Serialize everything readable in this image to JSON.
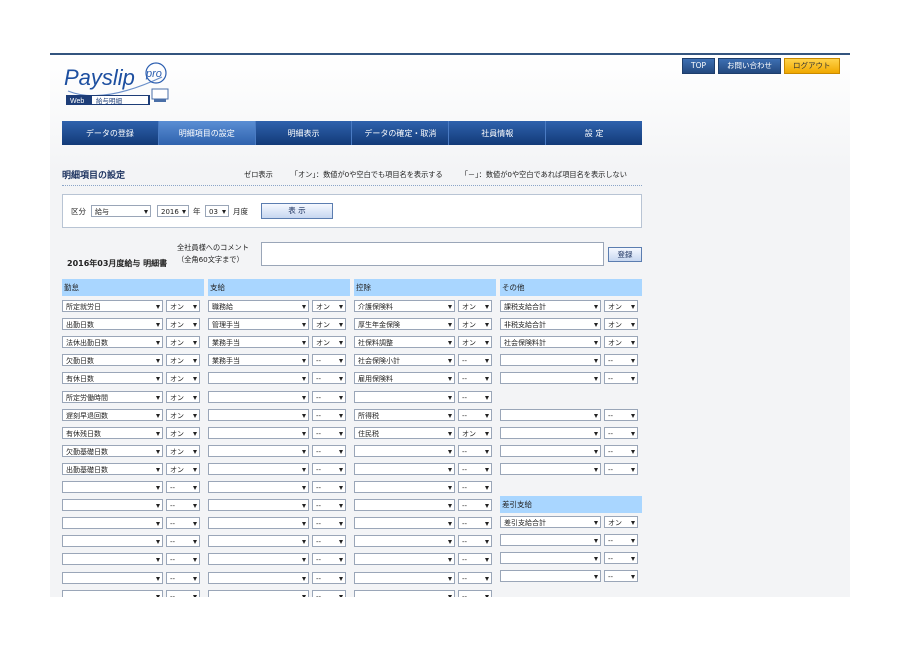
{
  "header": {
    "logo_text": "Payslip",
    "logo_pro": "pro",
    "logo_web": "Web",
    "logo_sub": "給与明細",
    "links": [
      {
        "label": "TOP",
        "name": "top-link"
      },
      {
        "label": "お問い合わせ",
        "name": "contact-link"
      },
      {
        "label": "ログアウト",
        "name": "logout-button"
      }
    ]
  },
  "nav": {
    "tabs": [
      {
        "label": "データの登録"
      },
      {
        "label": "明細項目の設定"
      },
      {
        "label": "明細表示"
      },
      {
        "label": "データの確定・取消"
      },
      {
        "label": "社員情報"
      },
      {
        "label": "設 定"
      }
    ]
  },
  "page": {
    "title": "明細項目の設定",
    "zero_label": "ゼロ表示",
    "zero_on": "「オン」：数値が0や空白でも項目名を表示する",
    "zero_off": "「－」：数値が0や空白であれば項目名を表示しない"
  },
  "selector": {
    "kubun_label": "区分",
    "kubun_value": "給与",
    "year_value": "2016",
    "year_label": "年",
    "month_value": "03",
    "month_label": "月度",
    "show_button": "表 示"
  },
  "comment": {
    "label_line1": "全社員様へのコメント",
    "label_line2": "（全角60文字まで）",
    "statement_title": "2016年03月度給与 明細書",
    "register_button": "登録"
  },
  "columns": [
    {
      "header": "勤怠",
      "items": [
        {
          "name": "所定就労日",
          "zero": "オン"
        },
        {
          "name": "出勤日数",
          "zero": "オン"
        },
        {
          "name": "法休出勤日数",
          "zero": "オン"
        },
        {
          "name": "欠勤日数",
          "zero": "オン"
        },
        {
          "name": "有休日数",
          "zero": "オン"
        },
        {
          "name": "所定労働時間",
          "zero": "オン"
        },
        {
          "name": "遅刻早退回数",
          "zero": "オン"
        },
        {
          "name": "有休残日数",
          "zero": "オン"
        },
        {
          "name": "欠勤基礎日数",
          "zero": "オン"
        },
        {
          "name": "出勤基礎日数",
          "zero": "オン"
        },
        {
          "name": "",
          "zero": "--"
        },
        {
          "name": "",
          "zero": "--"
        },
        {
          "name": "",
          "zero": "--"
        },
        {
          "name": "",
          "zero": "--"
        },
        {
          "name": "",
          "zero": "--"
        },
        {
          "name": "",
          "zero": "--"
        },
        {
          "name": "",
          "zero": "--"
        }
      ]
    },
    {
      "header": "支給",
      "items": [
        {
          "name": "職務給",
          "zero": "オン"
        },
        {
          "name": "管理手当",
          "zero": "オン"
        },
        {
          "name": "業務手当",
          "zero": "オン"
        },
        {
          "name": "業務手当",
          "zero": "--"
        },
        {
          "name": "",
          "zero": "--"
        },
        {
          "name": "",
          "zero": "--"
        },
        {
          "name": "",
          "zero": "--"
        },
        {
          "name": "",
          "zero": "--"
        },
        {
          "name": "",
          "zero": "--"
        },
        {
          "name": "",
          "zero": "--"
        },
        {
          "name": "",
          "zero": "--"
        },
        {
          "name": "",
          "zero": "--"
        },
        {
          "name": "",
          "zero": "--"
        },
        {
          "name": "",
          "zero": "--"
        },
        {
          "name": "",
          "zero": "--"
        },
        {
          "name": "",
          "zero": "--"
        },
        {
          "name": "",
          "zero": "--"
        }
      ]
    },
    {
      "header": "控除",
      "items": [
        {
          "name": "介護保険料",
          "zero": "オン"
        },
        {
          "name": "厚生年金保険",
          "zero": "オン"
        },
        {
          "name": "社保料調整",
          "zero": "オン"
        },
        {
          "name": "社会保険小計",
          "zero": "--"
        },
        {
          "name": "雇用保険料",
          "zero": "--"
        },
        {
          "name": "",
          "zero": "--"
        },
        {
          "name": "所得税",
          "zero": "--"
        },
        {
          "name": "住民税",
          "zero": "オン"
        },
        {
          "name": "",
          "zero": "--"
        },
        {
          "name": "",
          "zero": "--"
        },
        {
          "name": "",
          "zero": "--"
        },
        {
          "name": "",
          "zero": "--"
        },
        {
          "name": "",
          "zero": "--"
        },
        {
          "name": "",
          "zero": "--"
        },
        {
          "name": "",
          "zero": "--"
        },
        {
          "name": "",
          "zero": "--"
        },
        {
          "name": "",
          "zero": "--"
        }
      ]
    },
    {
      "header": "その他",
      "items": [
        {
          "name": "課税支給合計",
          "zero": "オン"
        },
        {
          "name": "非税支給合計",
          "zero": "オン"
        },
        {
          "name": "社会保険料計",
          "zero": "オン"
        },
        {
          "name": "",
          "zero": "--"
        },
        {
          "name": "",
          "zero": "--"
        },
        {
          "name": "",
          "zero": "--",
          "hidden": true
        },
        {
          "name": "",
          "zero": "--"
        },
        {
          "name": "",
          "zero": "--"
        },
        {
          "name": "",
          "zero": "--"
        },
        {
          "name": "",
          "zero": "--"
        }
      ]
    }
  ],
  "sashihiki": {
    "header": "差引支給",
    "items": [
      {
        "name": "差引支給合計",
        "zero": "オン"
      },
      {
        "name": "",
        "zero": "--"
      },
      {
        "name": "",
        "zero": "--"
      },
      {
        "name": "",
        "zero": "--"
      }
    ]
  }
}
